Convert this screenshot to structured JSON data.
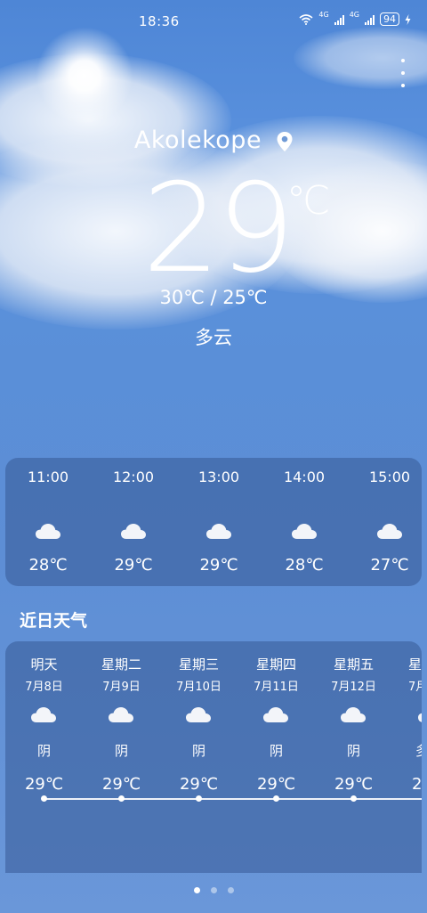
{
  "status_bar": {
    "time": "18:36",
    "network_1": "4G",
    "network_2": "4G",
    "battery": "94",
    "icons": [
      "wifi-icon",
      "signal-icon",
      "signal-icon",
      "battery-icon",
      "charging-icon"
    ]
  },
  "location": {
    "city": "Akolekope",
    "icon": "location-pin-icon"
  },
  "current": {
    "temperature": "29",
    "unit": "℃",
    "range": "30℃ / 25℃",
    "condition": "多云"
  },
  "hourly": [
    {
      "time": "11:00",
      "icon": "cloud-icon",
      "temp": "28℃"
    },
    {
      "time": "12:00",
      "icon": "cloud-icon",
      "temp": "29℃"
    },
    {
      "time": "13:00",
      "icon": "cloud-icon",
      "temp": "29℃"
    },
    {
      "time": "14:00",
      "icon": "cloud-icon",
      "temp": "28℃"
    },
    {
      "time": "15:00",
      "icon": "cloud-icon",
      "temp": "27℃"
    }
  ],
  "daily_section": {
    "title": "近日天气"
  },
  "daily": [
    {
      "day": "明天",
      "date": "7月8日",
      "icon": "cloud-icon",
      "weather": "阴",
      "temp": "29℃"
    },
    {
      "day": "星期二",
      "date": "7月9日",
      "icon": "cloud-icon",
      "weather": "阴",
      "temp": "29℃"
    },
    {
      "day": "星期三",
      "date": "7月10日",
      "icon": "cloud-icon",
      "weather": "阴",
      "temp": "29℃"
    },
    {
      "day": "星期四",
      "date": "7月11日",
      "icon": "cloud-icon",
      "weather": "阴",
      "temp": "29℃"
    },
    {
      "day": "星期五",
      "date": "7月12日",
      "icon": "cloud-icon",
      "weather": "阴",
      "temp": "29℃"
    },
    {
      "day": "星",
      "date": "7月",
      "icon": "cloud-icon",
      "weather": "多",
      "temp": "2"
    }
  ],
  "pager": {
    "pages": 3,
    "active": 1
  }
}
